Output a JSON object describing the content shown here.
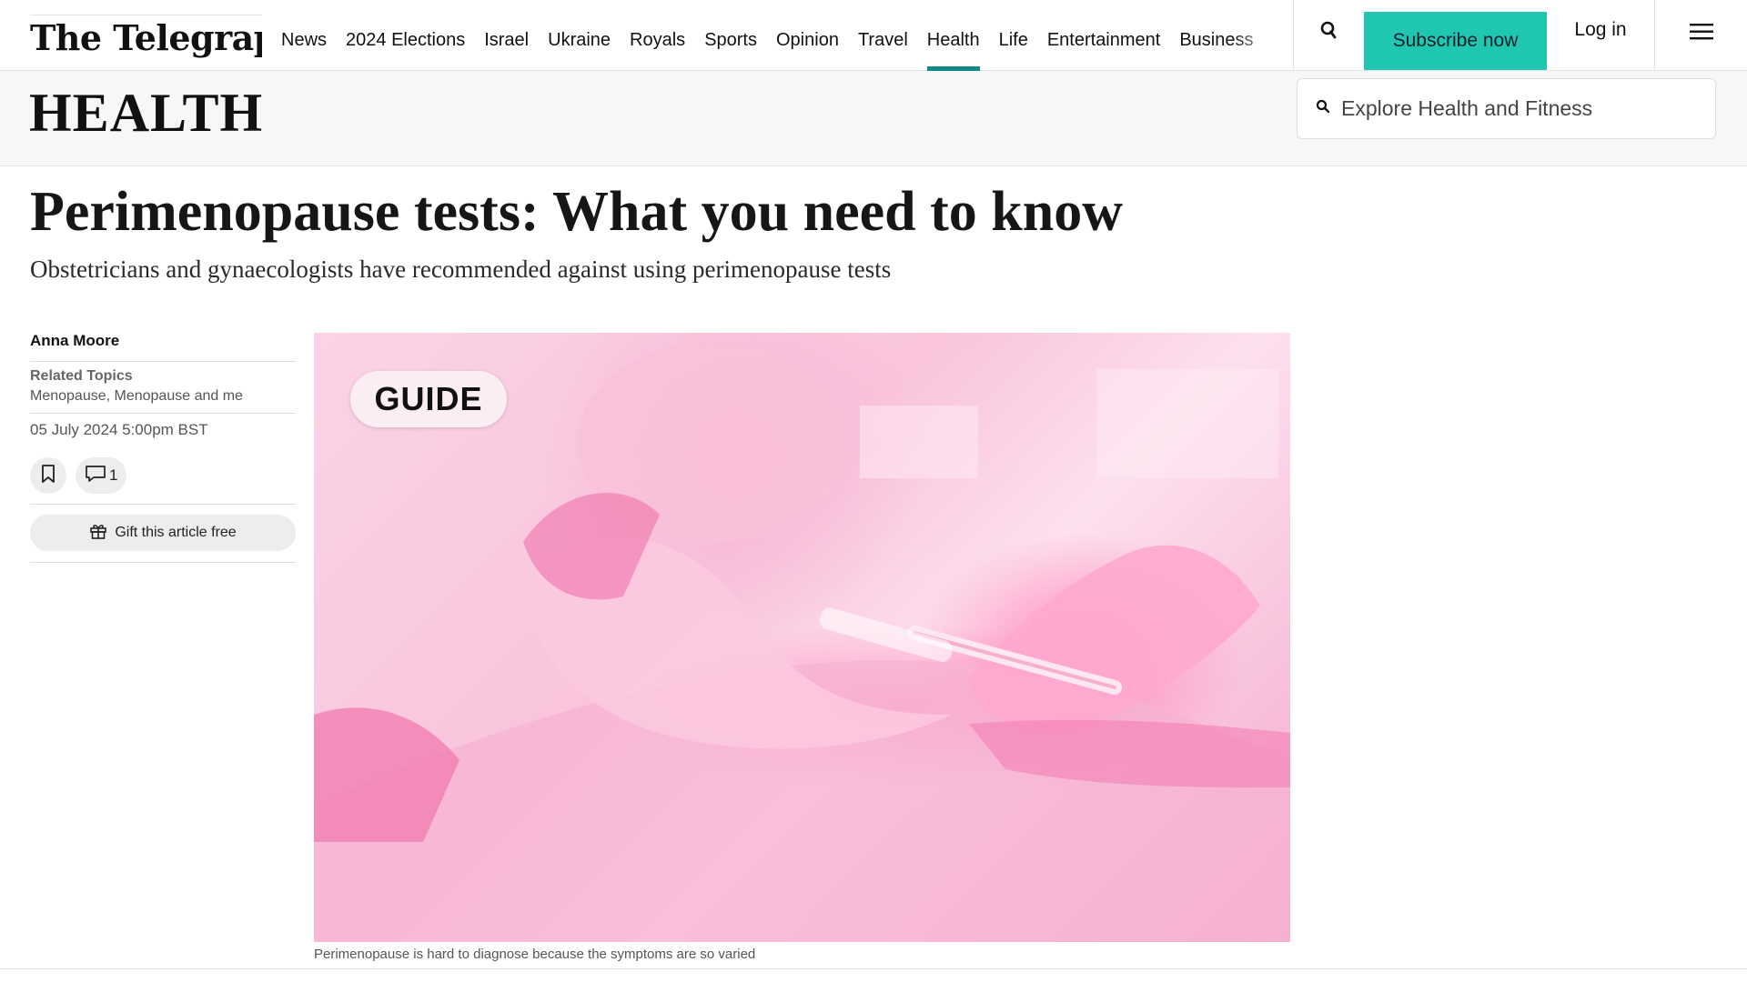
{
  "header": {
    "logo": "The Telegraph",
    "nav": [
      "News",
      "2024 Elections",
      "Israel",
      "Ukraine",
      "Royals",
      "Sports",
      "Opinion",
      "Travel",
      "Health",
      "Life",
      "Entertainment",
      "Business"
    ],
    "active_nav": "Health",
    "subscribe_label": "Subscribe now",
    "login_label": "Log in",
    "accent_color": "#1fc7b1",
    "active_underline_color": "#0e8a86"
  },
  "section": {
    "title": "HEALTH",
    "search_placeholder": "Explore Health and Fitness"
  },
  "article": {
    "headline": "Perimenopause tests: What you need to know",
    "standfirst": "Obstetricians and gynaecologists have recommended against using perimenopause tests",
    "author": "Anna Moore",
    "related_label": "Related Topics",
    "related_topics": "Menopause, Menopause and me",
    "date": "05 July 2024 5:00pm BST",
    "comment_count": "1",
    "gift_label": "Gift this article free",
    "badge": "GUIDE",
    "caption": "Perimenopause is hard to diagnose because the symptoms are so varied"
  }
}
